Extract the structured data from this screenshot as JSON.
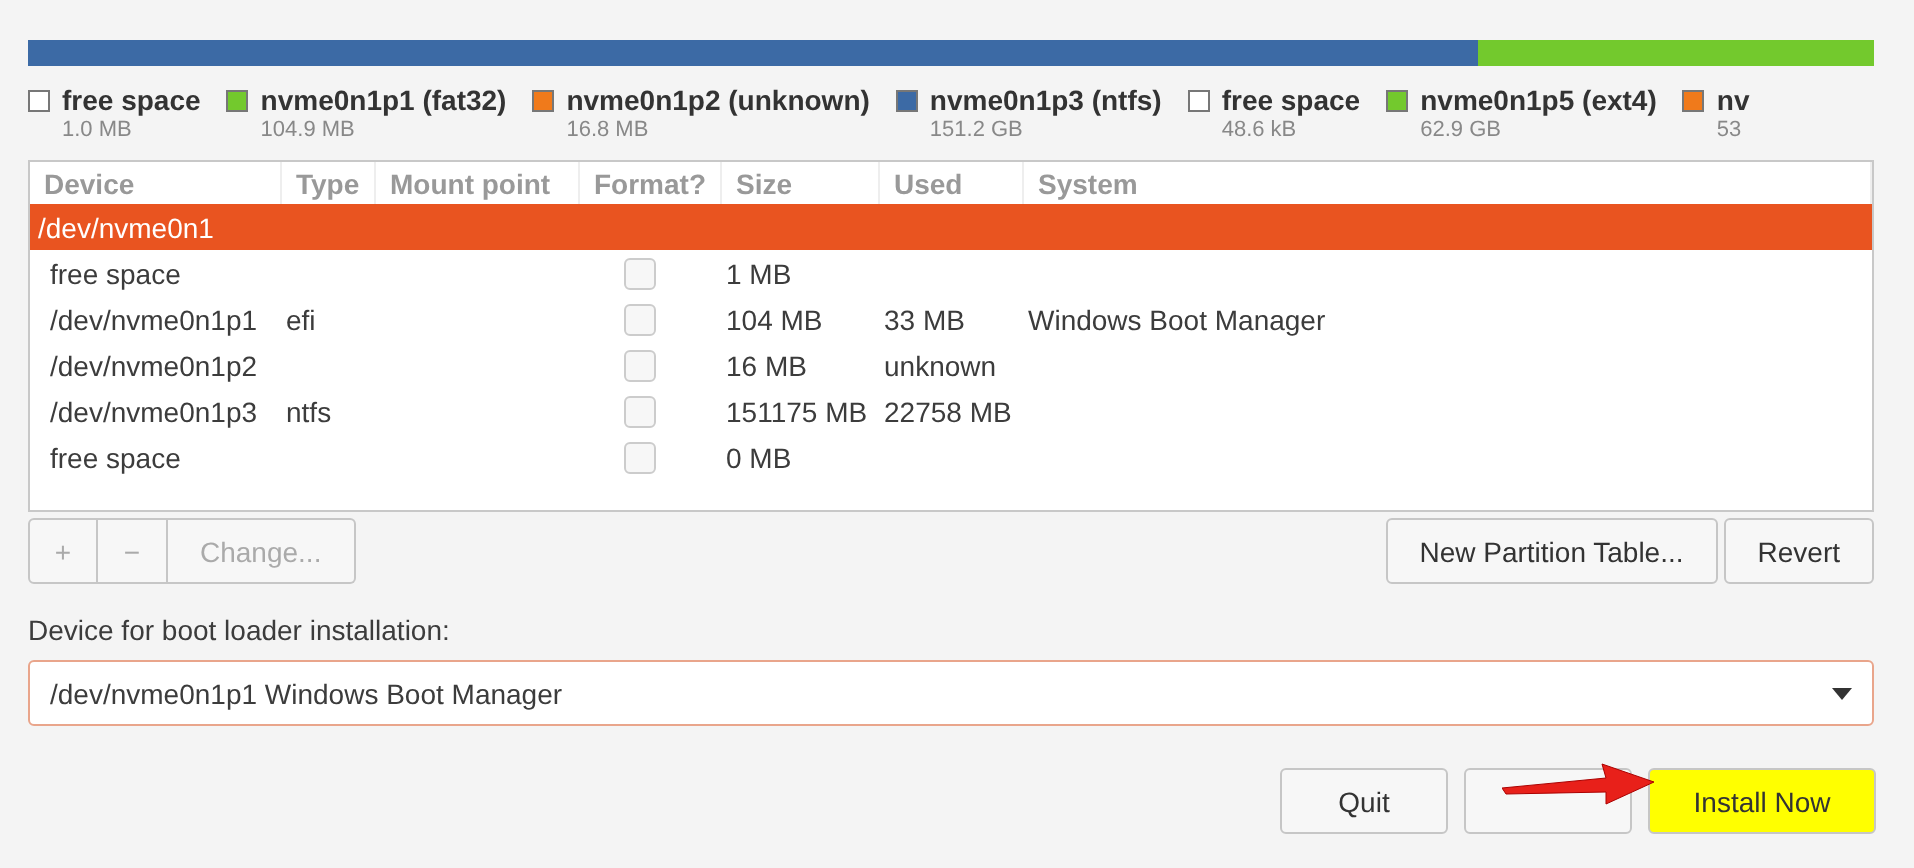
{
  "partition_bar": [
    {
      "color": "#3c6aa5",
      "level": 0.786
    },
    {
      "color": "#73c92d",
      "level": 0.214
    }
  ],
  "legend": [
    {
      "label": "free space",
      "size": "1.0 MB",
      "color": "#ffffff"
    },
    {
      "label": "nvme0n1p1 (fat32)",
      "size": "104.9 MB",
      "color": "#73c92d"
    },
    {
      "label": "nvme0n1p2 (unknown)",
      "size": "16.8 MB",
      "color": "#f07a1b"
    },
    {
      "label": "nvme0n1p3 (ntfs)",
      "size": "151.2 GB",
      "color": "#3c6aa5"
    },
    {
      "label": "free space",
      "size": "48.6 kB",
      "color": "#ffffff"
    },
    {
      "label": "nvme0n1p5 (ext4)",
      "size": "62.9 GB",
      "color": "#73c92d"
    },
    {
      "label": "nv",
      "size": "53",
      "color": "#f07a1b"
    }
  ],
  "table": {
    "columns": [
      "Device",
      "Type",
      "Mount point",
      "Format?",
      "Size",
      "Used",
      "System"
    ],
    "rows": [
      {
        "kind": "disk",
        "device": "/dev/nvme0n1",
        "selected": true
      },
      {
        "kind": "partition",
        "device": "free space",
        "format": false,
        "size": "1 MB"
      },
      {
        "kind": "partition",
        "device": "/dev/nvme0n1p1",
        "type": "efi",
        "format": false,
        "size": "104 MB",
        "used": "33 MB",
        "system": "Windows Boot Manager"
      },
      {
        "kind": "partition",
        "device": "/dev/nvme0n1p2",
        "format": false,
        "size": "16 MB",
        "used": "unknown"
      },
      {
        "kind": "partition",
        "device": "/dev/nvme0n1p3",
        "type": "ntfs",
        "format": false,
        "size": "151175 MB",
        "used": "22758 MB"
      },
      {
        "kind": "partition",
        "device": "free space",
        "format": false,
        "size": "0 MB"
      }
    ]
  },
  "edit_buttons": [
    {
      "label": "+",
      "disabled": true
    },
    {
      "label": "−",
      "disabled": true
    },
    {
      "label": "Change...",
      "disabled": true
    }
  ],
  "table_buttons": [
    "New Partition Table...",
    "Revert"
  ],
  "boot_loader": {
    "label": "Device for boot loader installation:",
    "value": "/dev/nvme0n1p1 Windows Boot Manager"
  },
  "buttons": [
    {
      "label": "Quit",
      "highlighted": false
    },
    {
      "highlighted": false
    },
    {
      "label": "Install Now",
      "highlighted": true
    }
  ]
}
